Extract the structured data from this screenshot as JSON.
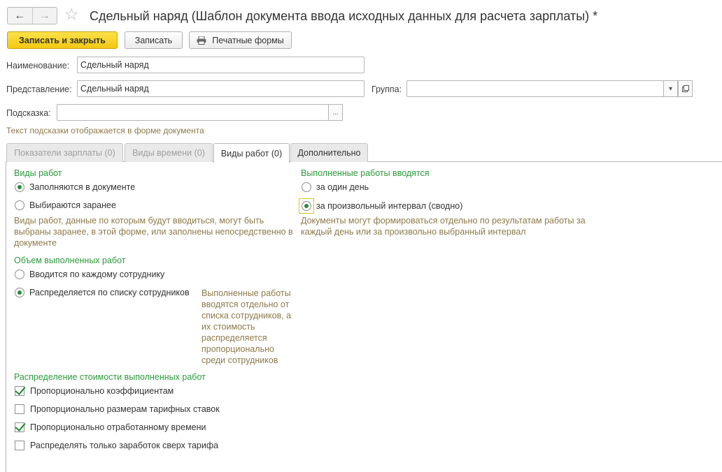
{
  "header": {
    "back_icon": "←",
    "forward_icon": "→",
    "star_icon": "☆",
    "title": "Сдельный наряд (Шаблон документа ввода исходных данных для расчета зарплаты) *"
  },
  "toolbar": {
    "save_close_label": "Записать и закрыть",
    "save_label": "Записать",
    "print_label": "Печатные формы"
  },
  "form": {
    "name_label": "Наименование:",
    "name_value": "Сдельный наряд",
    "presentation_label": "Представление:",
    "presentation_value": "Сдельный наряд",
    "group_label": "Группа:",
    "group_value": "",
    "hint_label": "Подсказка:",
    "hint_value": "",
    "hint_button": "...",
    "hint_note": "Текст подсказки отображается в форме документа"
  },
  "tabs": [
    {
      "label": "Показатели зарплаты (0)"
    },
    {
      "label": "Виды времени (0)"
    },
    {
      "label": "Виды работ (0)"
    },
    {
      "label": "Дополнительно"
    }
  ],
  "work_types": {
    "title": "Виды работ",
    "option_filled": "Заполняются в документе",
    "option_preselected": "Выбираются заранее",
    "description": "Виды работ, данные по которым будут вводиться, могут быть выбраны заранее, в этой форме, или заполнены непосредственно в документе"
  },
  "completed_entry": {
    "title": "Выполненные работы вводятся",
    "option_one_day": "за один день",
    "option_interval": "за произвольный интервал (сводно)",
    "description": "Документы могут формироваться отдельно по результатам работы за каждый день или за произвольно выбранный интервал"
  },
  "volume": {
    "title": "Объем выполненных работ",
    "option_each": "Вводится по каждому сотруднику",
    "option_distributed": "Распределяется по списку сотрудников",
    "description": "Выполненные работы вводятся отдельно от списка сотрудников, а их стоимость распределяется пропорционально среди сотрудников"
  },
  "distribution": {
    "title": "Распределение стоимости выполненных работ",
    "items": [
      {
        "label": "Пропорционально коэффициентам",
        "checked": true
      },
      {
        "label": "Пропорционально размерам тарифных ставок",
        "checked": false
      },
      {
        "label": "Пропорционально отработанному времени",
        "checked": true
      },
      {
        "label": "Распределять только заработок сверх тарифа",
        "checked": false
      }
    ]
  },
  "colors": {
    "accent_yellow": "#f3c812",
    "group_green": "#2a9a3a",
    "hint_brown": "#8c7a4a"
  }
}
